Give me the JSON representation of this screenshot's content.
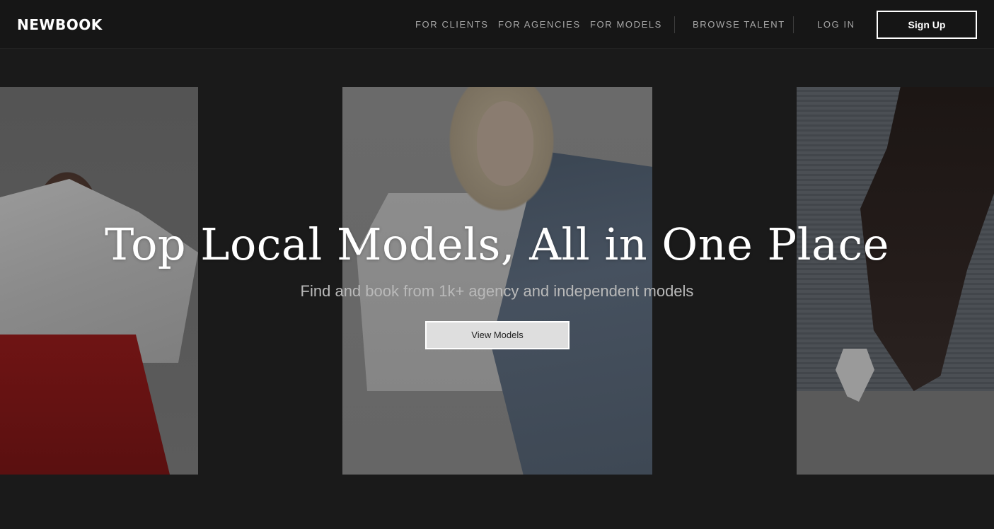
{
  "brand": {
    "logo_text": "NEWBOOK"
  },
  "nav": {
    "links": [
      {
        "label": "FOR CLIENTS"
      },
      {
        "label": "FOR AGENCIES"
      },
      {
        "label": "FOR MODELS"
      },
      {
        "label": "BROWSE TALENT"
      },
      {
        "label": "LOG IN"
      }
    ],
    "signup_label": "Sign Up"
  },
  "hero": {
    "title": "Top Local Models, All in One Place",
    "subtitle": "Find and book from 1k+ agency and independent models",
    "cta_label": "View Models",
    "images": [
      {
        "description_name": "model-photo-left"
      },
      {
        "description_name": "model-photo-center"
      },
      {
        "description_name": "model-photo-right"
      }
    ]
  },
  "colors": {
    "background": "#1a1a1a",
    "header_background": "#161616",
    "nav_text": "#a8a8a8",
    "accent_white": "#ffffff",
    "subtitle_text": "#b9b9b9"
  }
}
